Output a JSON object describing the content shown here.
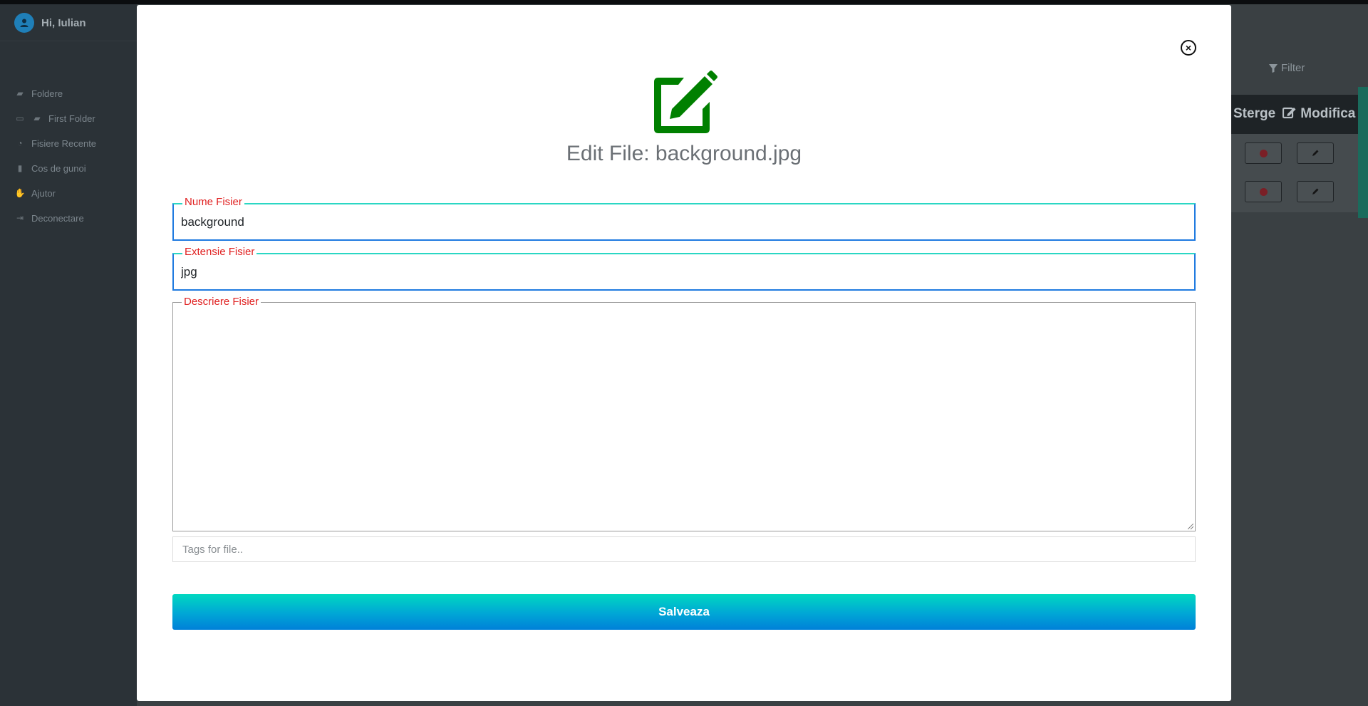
{
  "sidebar": {
    "greeting": "Hi, Iulian",
    "items": [
      {
        "label": "Foldere",
        "icon": "folder-open-icon"
      },
      {
        "label": "First Folder",
        "icon": "folder-icon"
      },
      {
        "label": "Fisiere Recente",
        "icon": "clock-icon"
      },
      {
        "label": "Cos de gunoi",
        "icon": "trash-icon"
      },
      {
        "label": "Ajutor",
        "icon": "hands-helping-icon"
      },
      {
        "label": "Deconectare",
        "icon": "sign-out-icon"
      }
    ]
  },
  "toolbar": {
    "filter_label": "Filter"
  },
  "table": {
    "col_delete": "Sterge",
    "col_edit": "Modifica"
  },
  "modal": {
    "title": "Edit File: background.jpg",
    "name_label": "Nume Fisier",
    "name_value": "background",
    "ext_label": "Extensie Fisier",
    "ext_value": "jpg",
    "desc_label": "Descriere Fisier",
    "desc_value": "",
    "tags_placeholder": "Tags for file..",
    "save_label": "Salveaza"
  },
  "colors": {
    "edit_icon": "#008000",
    "label_red": "#e02020",
    "save_gradient_top": "#00d8c0",
    "save_gradient_bottom": "#0080d8"
  }
}
